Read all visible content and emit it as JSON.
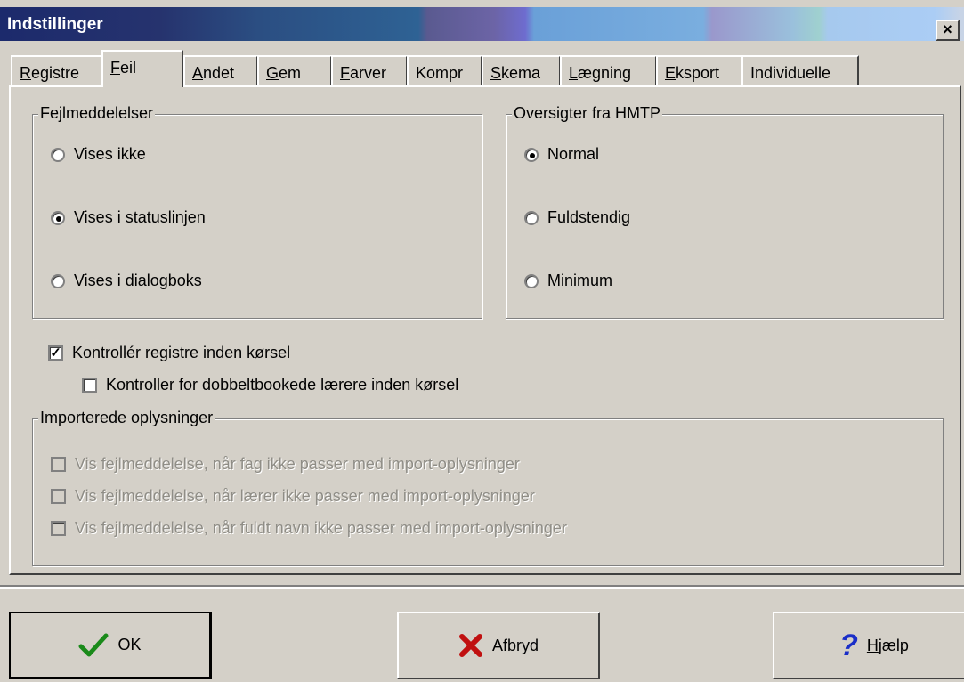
{
  "window": {
    "title": "Indstillinger",
    "close_label": "×"
  },
  "tabs": [
    {
      "label": "Registre",
      "key": "R",
      "rest": "egistre"
    },
    {
      "label": "Feil",
      "key": "F",
      "rest": "eil"
    },
    {
      "label": "Andet",
      "key": "A",
      "rest": "ndet"
    },
    {
      "label": "Gem",
      "key": "G",
      "rest": "em"
    },
    {
      "label": "Farver",
      "key": "F",
      "rest": "arver"
    },
    {
      "label": "Kompr",
      "key": "",
      "rest": "Kompr"
    },
    {
      "label": "Skema",
      "key": "S",
      "rest": "kema"
    },
    {
      "label": "Lægning",
      "key": "L",
      "rest": "ægning"
    },
    {
      "label": "Eksport",
      "key": "E",
      "rest": "ksport"
    },
    {
      "label": "Individuelle",
      "key": "",
      "rest": "Individuelle"
    }
  ],
  "active_tab": "Feil",
  "fejlmeddelelser": {
    "legend": "Fejlmeddelelser",
    "options": [
      "Vises ikke",
      "Vises i statuslinjen",
      "Vises i dialogboks"
    ],
    "selected": "Vises i statuslinjen"
  },
  "oversigter": {
    "legend": "Oversigter fra HMTP",
    "options": [
      "Normal",
      "Fuldstendig",
      "Minimum"
    ],
    "selected": "Normal"
  },
  "checks": {
    "kontroller_registre": {
      "label": "Kontrollér registre inden kørsel",
      "checked": true
    },
    "kontroller_dobbelt": {
      "label": "Kontroller for dobbeltbookede lærere inden kørsel",
      "checked": false
    }
  },
  "importerede": {
    "legend": "Importerede oplysninger",
    "items": [
      "Vis fejlmeddelelse, når fag ikke passer med import-oplysninger",
      "Vis fejlmeddelelse, når lærer ikke passer med import-oplysninger",
      "Vis fejlmeddelelse, når fuldt navn ikke passer med import-oplysninger"
    ]
  },
  "buttons": {
    "ok": "OK",
    "cancel": "Afbryd",
    "help_key": "H",
    "help_rest": "jælp"
  },
  "icons": {
    "ok": "check-icon",
    "cancel": "x-icon",
    "help": "question-icon"
  },
  "colors": {
    "ok_check": "#1a8a1a",
    "cancel_x": "#c01010",
    "help_q": "#1a2ec8"
  }
}
